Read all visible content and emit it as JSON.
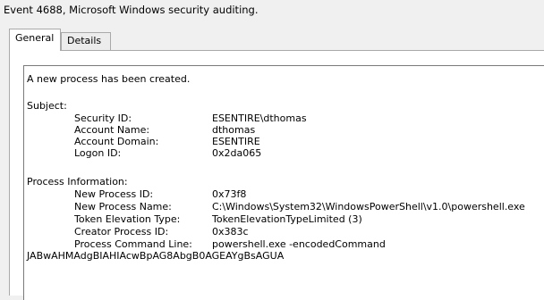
{
  "window": {
    "title": "Event 4688, Microsoft Windows security auditing."
  },
  "tabs": [
    {
      "label": "General",
      "active": true
    },
    {
      "label": "Details",
      "active": false
    }
  ],
  "event": {
    "summary": "A new process has been created.",
    "subject": {
      "heading": "Subject:",
      "security_id_label": "Security ID:",
      "security_id": "ESENTIRE\\dthomas",
      "account_name_label": "Account Name:",
      "account_name": "dthomas",
      "account_domain_label": "Account Domain:",
      "account_domain": "ESENTIRE",
      "logon_id_label": "Logon ID:",
      "logon_id": "0x2da065"
    },
    "process": {
      "heading": "Process Information:",
      "new_process_id_label": "New Process ID:",
      "new_process_id": "0x73f8",
      "new_process_name_label": "New Process Name:",
      "new_process_name": "C:\\Windows\\System32\\WindowsPowerShell\\v1.0\\powershell.exe",
      "token_elevation_label": "Token Elevation Type:",
      "token_elevation": "TokenElevationTypeLimited (3)",
      "creator_process_id_label": "Creator Process ID:",
      "creator_process_id": "0x383c",
      "command_line_label": "Process Command Line:",
      "command_line": "powershell.exe  -encodedCommand",
      "command_line_cont": "JABwAHMAdgBIAHIAcwBpAG8AbgB0AGEAYgBsAGUA"
    }
  }
}
